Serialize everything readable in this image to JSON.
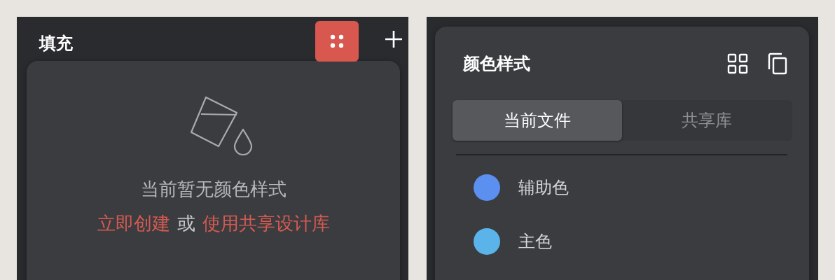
{
  "fill_panel": {
    "title": "填充",
    "empty_state": {
      "message": "当前暂无颜色样式",
      "prompt": [
        {
          "kind": "link",
          "text": "立即创建"
        },
        {
          "kind": "text",
          "text": "或"
        },
        {
          "kind": "link",
          "text": "使用共享设计库"
        }
      ]
    }
  },
  "color_styles": {
    "title": "颜色样式",
    "tabs": [
      {
        "label": "当前文件",
        "selected": true
      },
      {
        "label": "共享库",
        "selected": false
      }
    ],
    "styles": [
      {
        "name": "辅助色",
        "color": "#5b8ff0"
      },
      {
        "name": "主色",
        "color": "#5ab4ea"
      }
    ]
  }
}
